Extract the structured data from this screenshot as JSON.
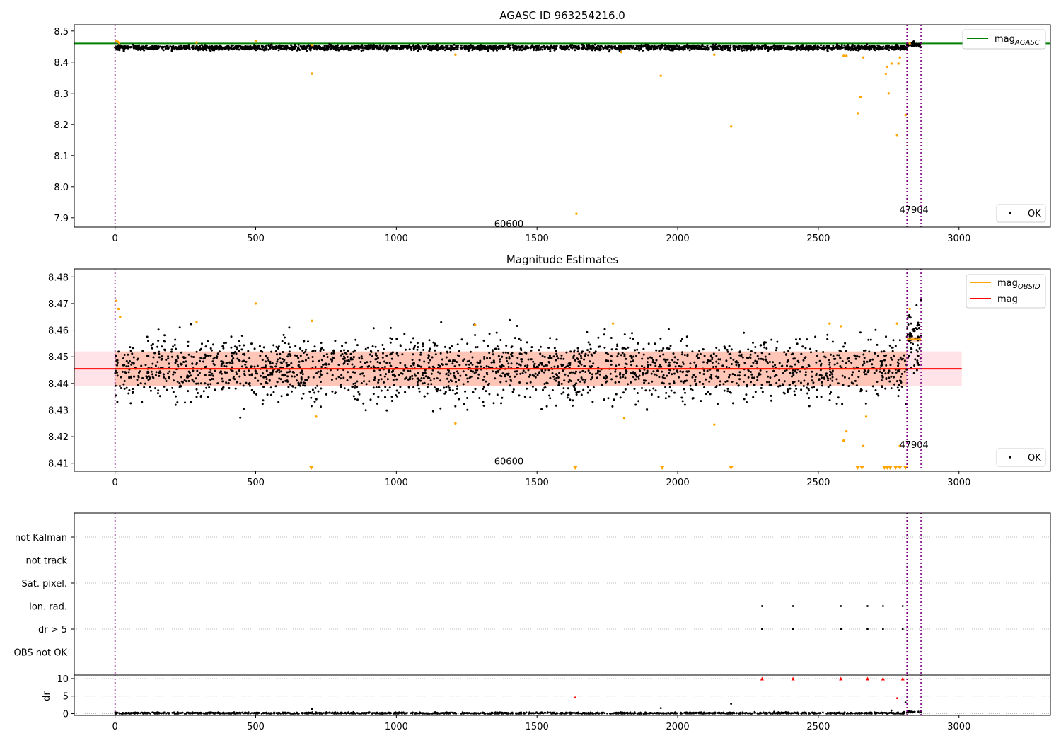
{
  "colors": {
    "ok_points": "#000000",
    "excluded_points": "#ffa500",
    "mag_agasc_line": "#008000",
    "mag_line": "#ff0000",
    "mag_obsid_line": "#ffa500",
    "band_fill": "#ffc0cb",
    "obsid_band_fill": "#ffa07a",
    "obsid_boundary": "#800080",
    "flag_point_dr": "#ff0000"
  },
  "chart_data": [
    {
      "type": "scatter",
      "title": "AGASC ID 963254216.0",
      "xlim": [
        -145,
        3325
      ],
      "ylim": [
        7.87,
        8.52
      ],
      "x_ticks": [
        0,
        500,
        1000,
        1500,
        2000,
        2500,
        3000
      ],
      "y_ticks": [
        7.9,
        8.0,
        8.1,
        8.2,
        8.3,
        8.4,
        8.5
      ],
      "obsid_boundaries": [
        0,
        2815,
        2865
      ],
      "obsid_labels": [
        {
          "text": "60600",
          "x": 1400,
          "y": 7.87
        },
        {
          "text": "47904",
          "x": 2840,
          "y": 7.915
        }
      ],
      "hlines": [
        {
          "name": "mag_agasc",
          "y": 8.46
        }
      ],
      "ok_cloud": {
        "x_range": [
          0,
          2865
        ],
        "mean": 8.447,
        "spread": 0.004
      },
      "excluded_points": [
        [
          5,
          8.468
        ],
        [
          10,
          8.465
        ],
        [
          15,
          8.462
        ],
        [
          290,
          8.463
        ],
        [
          500,
          8.468
        ],
        [
          700,
          8.363
        ],
        [
          700,
          8.455
        ],
        [
          1210,
          8.424
        ],
        [
          1640,
          7.913
        ],
        [
          1800,
          8.432
        ],
        [
          1940,
          8.356
        ],
        [
          2130,
          8.424
        ],
        [
          2190,
          8.193
        ],
        [
          2590,
          8.42
        ],
        [
          2600,
          8.42
        ],
        [
          2640,
          8.236
        ],
        [
          2650,
          8.288
        ],
        [
          2660,
          8.415
        ],
        [
          2740,
          8.362
        ],
        [
          2745,
          8.385
        ],
        [
          2750,
          8.3
        ],
        [
          2760,
          8.395
        ],
        [
          2780,
          8.166
        ],
        [
          2785,
          8.395
        ],
        [
          2790,
          8.415
        ],
        [
          2810,
          8.23
        ],
        [
          2825,
          8.46
        ]
      ],
      "legend": [
        "mag_AGASC",
        "OK"
      ]
    },
    {
      "type": "scatter",
      "title": "Magnitude Estimates",
      "xlim": [
        -145,
        3325
      ],
      "ylim": [
        8.407,
        8.483
      ],
      "x_ticks": [
        0,
        500,
        1000,
        1500,
        2000,
        2500,
        3000
      ],
      "y_ticks": [
        8.41,
        8.42,
        8.43,
        8.44,
        8.45,
        8.46,
        8.47,
        8.48
      ],
      "obsid_boundaries": [
        0,
        2815,
        2865
      ],
      "obsid_labels": [
        {
          "text": "60600",
          "x": 1400,
          "y": 8.4095
        },
        {
          "text": "47904",
          "x": 2840,
          "y": 8.4158
        }
      ],
      "mag": {
        "value": 8.4455,
        "band": [
          8.439,
          8.452
        ],
        "x_range": [
          -145,
          3010
        ]
      },
      "obsid_segments": [
        {
          "x_range": [
            0,
            2815
          ],
          "mag": 8.4455,
          "band": [
            8.439,
            8.452
          ]
        },
        {
          "x_range": [
            2815,
            2865
          ],
          "mag": 8.4566,
          "band": [
            8.4555,
            8.4575
          ]
        }
      ],
      "ok_cloud": {
        "x_range": [
          0,
          2815
        ],
        "mean": 8.4455,
        "spread": 0.0058
      },
      "ok_cloud_2": {
        "x_range": [
          2815,
          2865
        ],
        "mean": 8.457,
        "spread": 0.006
      },
      "excluded_points": [
        [
          5,
          8.471
        ],
        [
          12,
          8.468
        ],
        [
          18,
          8.465
        ],
        [
          290,
          8.463
        ],
        [
          500,
          8.47
        ],
        [
          700,
          8.4635
        ],
        [
          715,
          8.4275
        ],
        [
          1210,
          8.425
        ],
        [
          1280,
          8.462
        ],
        [
          1770,
          8.4625
        ],
        [
          1810,
          8.427
        ],
        [
          2130,
          8.4245
        ],
        [
          2540,
          8.4625
        ],
        [
          2580,
          8.4615
        ],
        [
          2590,
          8.4185
        ],
        [
          2600,
          8.422
        ],
        [
          2660,
          8.4165
        ],
        [
          2670,
          8.4275
        ],
        [
          2780,
          8.4625
        ],
        [
          2790,
          8.4165
        ],
        [
          2825,
          8.468
        ]
      ],
      "below_markers": [
        698,
        1636,
        1945,
        2190,
        2640,
        2655,
        2735,
        2745,
        2755,
        2775,
        2790,
        2810
      ],
      "legend": [
        "mag_OBSID",
        "mag",
        "OK"
      ]
    },
    {
      "type": "scatter",
      "title": "",
      "xlim": [
        -145,
        3325
      ],
      "x_ticks": [
        0,
        500,
        1000,
        1500,
        2000,
        2500,
        3000
      ],
      "flag_rows": [
        "not Kalman",
        "not track",
        "Sat. pixel.",
        "Ion. rad.",
        "dr > 5",
        "OBS not OK"
      ],
      "flag_points": {
        "Ion. rad.": [
          2300,
          2410,
          2580,
          2675,
          2730,
          2800
        ],
        "dr > 5": [
          2300,
          2410,
          2580,
          2675,
          2730,
          2800
        ]
      },
      "obsid_boundaries": [
        0,
        2815,
        2865
      ]
    },
    {
      "type": "scatter",
      "title": "",
      "ylabel": "dr",
      "xlim": [
        -145,
        3325
      ],
      "ylim": [
        -0.5,
        11
      ],
      "x_ticks": [
        0,
        500,
        1000,
        1500,
        2000,
        2500,
        3000
      ],
      "y_ticks": [
        0,
        5,
        10
      ],
      "ok_cloud": {
        "x_range": [
          0,
          2865
        ],
        "mean": 0.15,
        "spread": 0.12
      },
      "clipped_at_10": [
        2300,
        2410,
        2580,
        2675,
        2730,
        2800
      ],
      "outliers": [
        [
          700,
          1.3
        ],
        [
          1636,
          4.6
        ],
        [
          1940,
          1.6
        ],
        [
          2190,
          2.8
        ],
        [
          2760,
          0.9
        ],
        [
          2780,
          4.4
        ],
        [
          2810,
          3.2
        ]
      ],
      "obsid_boundaries": [
        0,
        2815,
        2865
      ]
    }
  ],
  "legend_labels": {
    "mag_agasc": "mag",
    "mag_agasc_sub": "AGASC",
    "mag_obsid": "mag",
    "mag_obsid_sub": "OBSID",
    "mag": "mag",
    "ok": "OK"
  }
}
